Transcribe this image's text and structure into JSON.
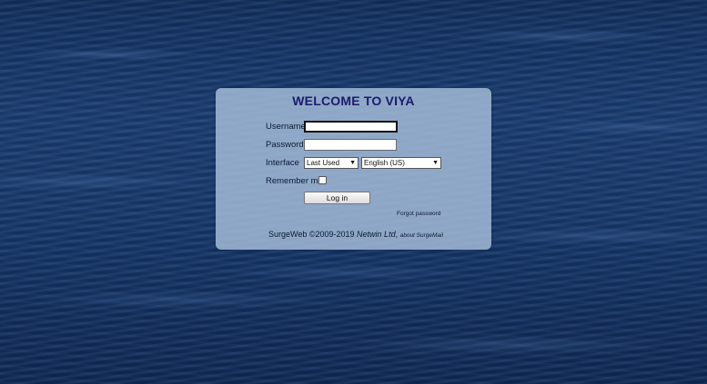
{
  "login": {
    "title": "WELCOME TO VIYA",
    "username_label": "Username",
    "password_label": "Password",
    "interface_label": "Interface",
    "interface_selected": "Last Used",
    "language_selected": "English (US)",
    "remember_label": "Remember me",
    "login_button": "Log in",
    "forgot_link": "Forgot password",
    "username_value": "",
    "password_value": ""
  },
  "footer": {
    "copyright": "SurgeWeb ©2009-2019",
    "company": "Netwin Ltd",
    "about_link": "about SurgeMail"
  },
  "colors": {
    "title": "#1c1a6e",
    "panel": "#a8c0da",
    "background": "#17396c"
  },
  "icons": {
    "select_chevron": "chevron-down-icon"
  }
}
